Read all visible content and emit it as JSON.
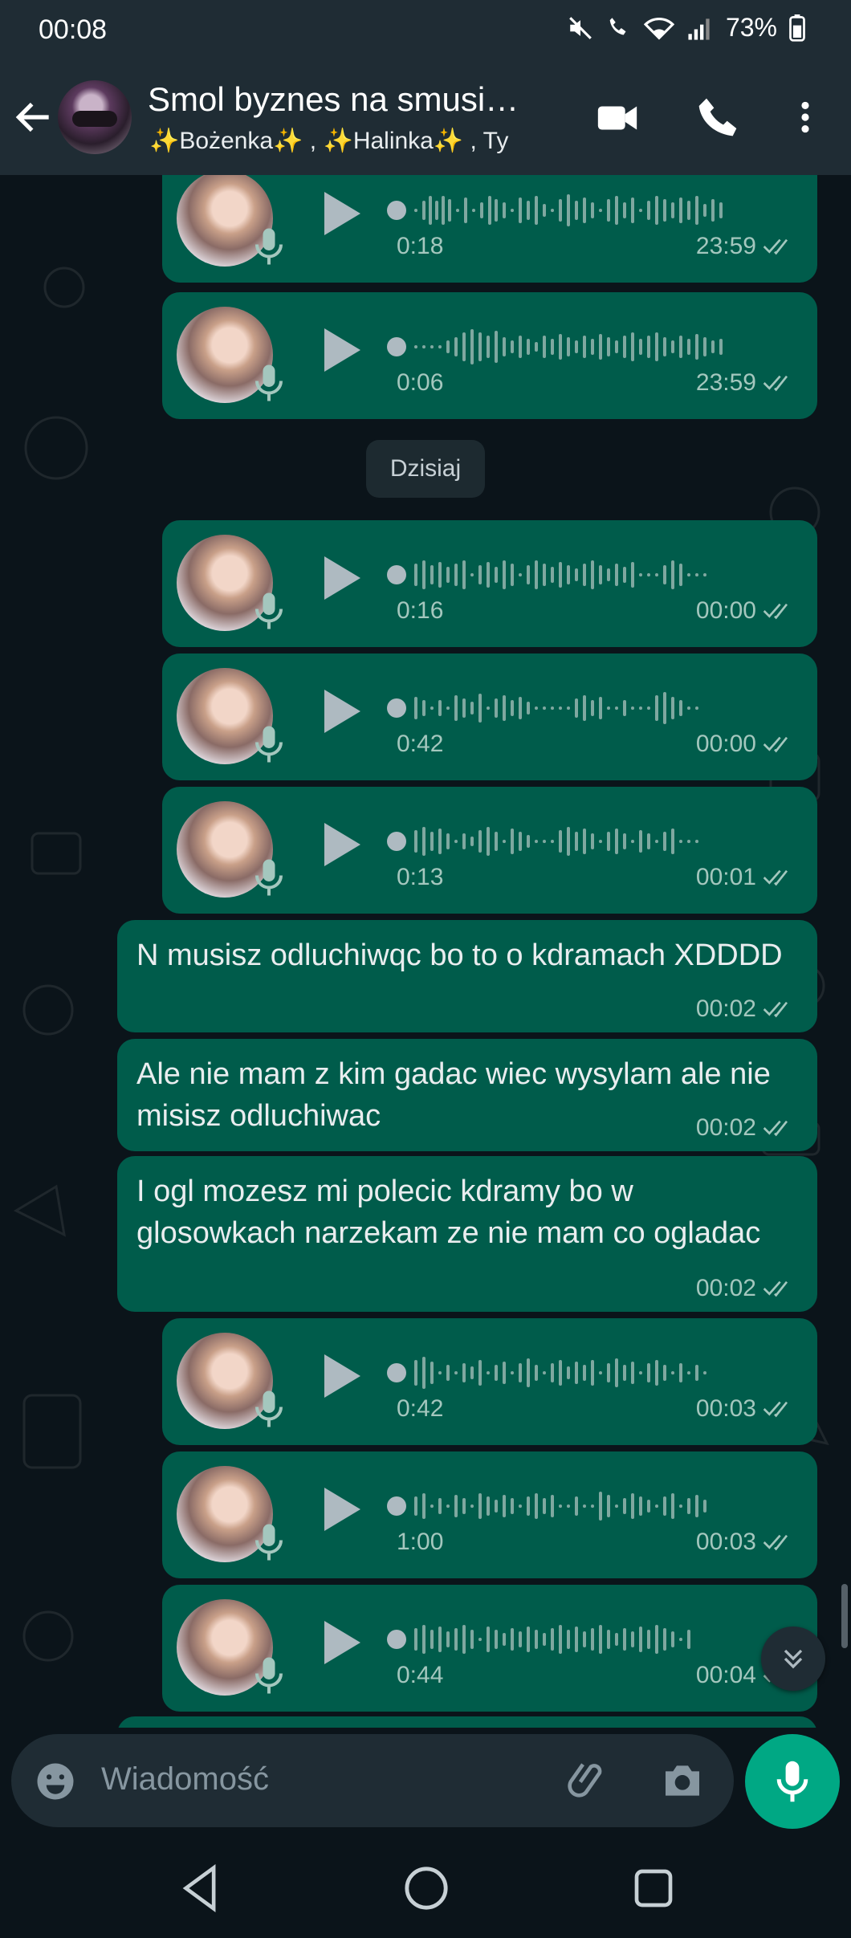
{
  "status": {
    "time": "00:08",
    "battery": "73%"
  },
  "header": {
    "title": "Smol byznes na smusi…",
    "subtitle": "✨Bożenka✨ ,  ✨Halinka✨ , Ty"
  },
  "date_divider": "Dzisiaj",
  "messages": [
    {
      "type": "voice",
      "duration": "0:18",
      "time": "23:59"
    },
    {
      "type": "voice",
      "duration": "0:06",
      "time": "23:59"
    },
    {
      "type": "voice",
      "duration": "0:16",
      "time": "00:00"
    },
    {
      "type": "voice",
      "duration": "0:42",
      "time": "00:00"
    },
    {
      "type": "voice",
      "duration": "0:13",
      "time": "00:01"
    },
    {
      "type": "text",
      "text": "N musisz odluchiwqc bo to o kdramach XDDDD",
      "time": "00:02"
    },
    {
      "type": "text",
      "text": "Ale nie mam z kim gadac wiec wysylam ale nie misisz odluchiwac",
      "time": "00:02"
    },
    {
      "type": "text",
      "text": "I ogl mozesz mi polecic kdramy bo w glosowkach narzekam ze nie mam co ogladac",
      "time": "00:02"
    },
    {
      "type": "voice",
      "duration": "0:42",
      "time": "00:03"
    },
    {
      "type": "voice",
      "duration": "1:00",
      "time": "00:03"
    },
    {
      "type": "voice",
      "duration": "0:44",
      "time": "00:04"
    }
  ],
  "input": {
    "placeholder": "Wiadomość"
  },
  "colors": {
    "bubble_out": "#005c4b",
    "header": "#1f2c34",
    "accent": "#00a884",
    "background": "#0b141a"
  },
  "icons": [
    "back-arrow-icon",
    "video-call-icon",
    "phone-icon",
    "more-vert-icon",
    "play-icon",
    "mic-icon",
    "double-check-icon",
    "emoji-icon",
    "attach-icon",
    "camera-icon",
    "chevron-double-down-icon"
  ]
}
